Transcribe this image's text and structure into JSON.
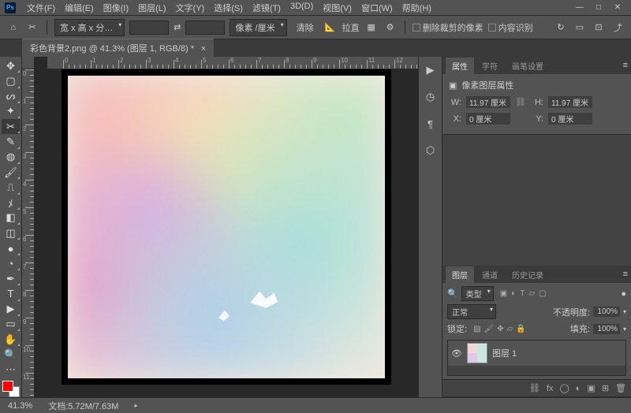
{
  "menu": [
    "文件(F)",
    "编辑(E)",
    "图像(I)",
    "图层(L)",
    "文字(Y)",
    "选择(S)",
    "滤镜(T)",
    "3D(D)",
    "视图(V)",
    "窗口(W)",
    "帮助(H)"
  ],
  "options": {
    "ratio": "宽 x 高 x 分…",
    "unit": "像素 /厘米",
    "clear": "清除",
    "straighten": "拉直",
    "delete_cropped": "删除裁剪的像素",
    "content_aware": "内容识别"
  },
  "document": {
    "tab": "彩色背景2.png @ 41.3% (图层 1, RGB/8) *",
    "zoom": "41.3%",
    "docinfo": "文档:5.72M/7.63M"
  },
  "panels": {
    "props": {
      "tabs": [
        "属性",
        "字符",
        "画笔设置"
      ],
      "title": "像素图层属性",
      "w_lbl": "W:",
      "w": "11.97 厘米",
      "h_lbl": "H:",
      "h": "11.97 厘米",
      "x_lbl": "X:",
      "x": "0 厘米",
      "y_lbl": "Y:",
      "y": "0 厘米"
    },
    "layers": {
      "tabs": [
        "图层",
        "通道",
        "历史记录"
      ],
      "kind": "类型",
      "blend": "正常",
      "opacity_lbl": "不透明度:",
      "opacity": "100%",
      "lock_lbl": "锁定:",
      "fill_lbl": "填充:",
      "fill": "100%",
      "items": [
        {
          "name": "图层 1"
        }
      ]
    }
  }
}
